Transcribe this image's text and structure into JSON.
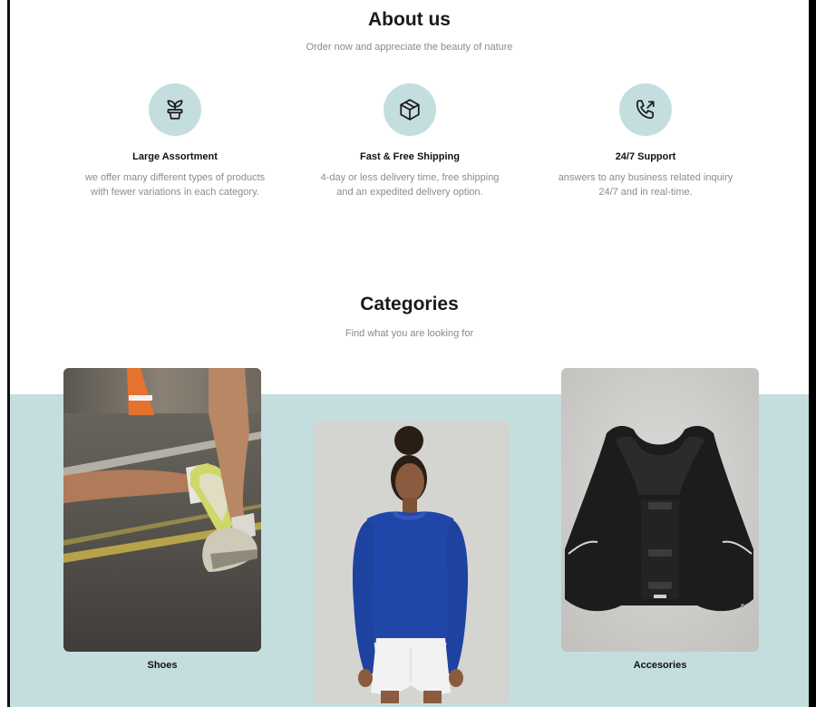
{
  "about": {
    "title": "About us",
    "subtitle": "Order now and appreciate the beauty of nature",
    "features": [
      {
        "icon": "plant-icon",
        "title": "Large Assortment",
        "desc_line1": "we offer many different types of products",
        "desc_line2": "with fewer variations in each category."
      },
      {
        "icon": "box-icon",
        "title": "Fast & Free Shipping",
        "desc_line1": "4-day or less delivery time, free shipping",
        "desc_line2": "and an expedited delivery option."
      },
      {
        "icon": "phone-icon",
        "title": "24/7 Support",
        "desc_line1": "answers to any business related inquiry",
        "desc_line2": "24/7 and in real-time."
      }
    ]
  },
  "categories": {
    "title": "Categories",
    "subtitle": "Find what you are looking for",
    "items": [
      {
        "label": "Shoes",
        "image": "running-shoes-photo"
      },
      {
        "label": "",
        "image": "woman-blue-top-photo"
      },
      {
        "label": "Accesories",
        "image": "running-vest-photo"
      }
    ]
  },
  "colors": {
    "accent": "#c4dedf",
    "heading": "#1a1a1a",
    "muted": "#8c8c8c"
  }
}
